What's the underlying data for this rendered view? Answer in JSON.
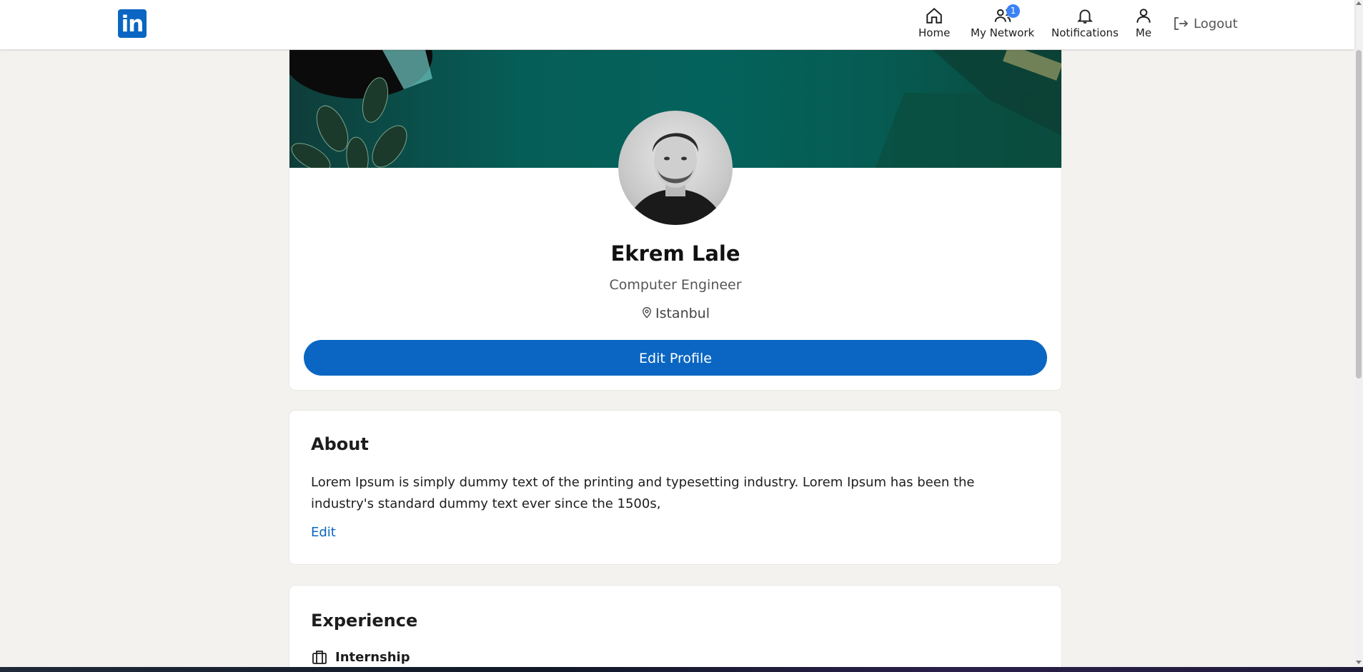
{
  "header": {
    "logo_text": "in",
    "nav": [
      {
        "label": "Home",
        "icon": "home-icon"
      },
      {
        "label": "My Network",
        "icon": "network-icon",
        "badge": "1"
      },
      {
        "label": "Notifications",
        "icon": "bell-icon"
      },
      {
        "label": "Me",
        "icon": "user-icon"
      }
    ],
    "logout_label": "Logout"
  },
  "profile": {
    "name": "Ekrem Lale",
    "headline": "Computer Engineer",
    "location": "Istanbul",
    "edit_button": "Edit Profile"
  },
  "about": {
    "title": "About",
    "text": "Lorem Ipsum is simply dummy text of the printing and typesetting industry. Lorem Ipsum has been the industry's standard dummy text ever since the 1500s,",
    "edit_label": "Edit"
  },
  "experience": {
    "title": "Experience",
    "items": [
      {
        "title": "Internship",
        "icon": "briefcase-icon"
      }
    ]
  },
  "colors": {
    "brand": "#0a66c2",
    "badge": "#3b82f6",
    "background": "#f3f2ef"
  }
}
